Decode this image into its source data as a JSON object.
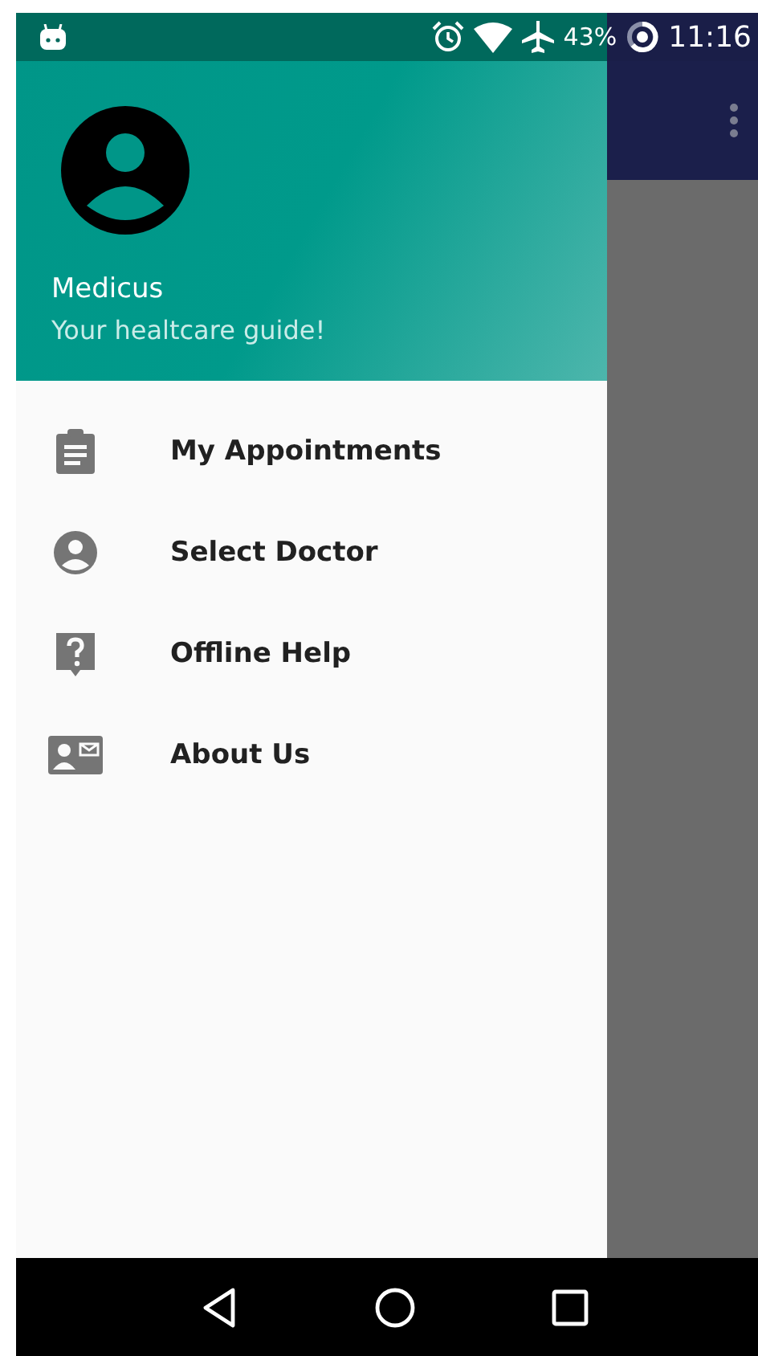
{
  "status_bar": {
    "battery": "43%",
    "time": "11:16"
  },
  "drawer": {
    "header": {
      "title": "Medicus",
      "subtitle": "Your healtcare guide!"
    },
    "items": [
      {
        "label": "My Appointments",
        "kind": "clipboard"
      },
      {
        "label": "Select Doctor",
        "kind": "person"
      },
      {
        "label": "Offline Help",
        "kind": "help"
      },
      {
        "label": "About Us",
        "kind": "contact"
      }
    ]
  }
}
